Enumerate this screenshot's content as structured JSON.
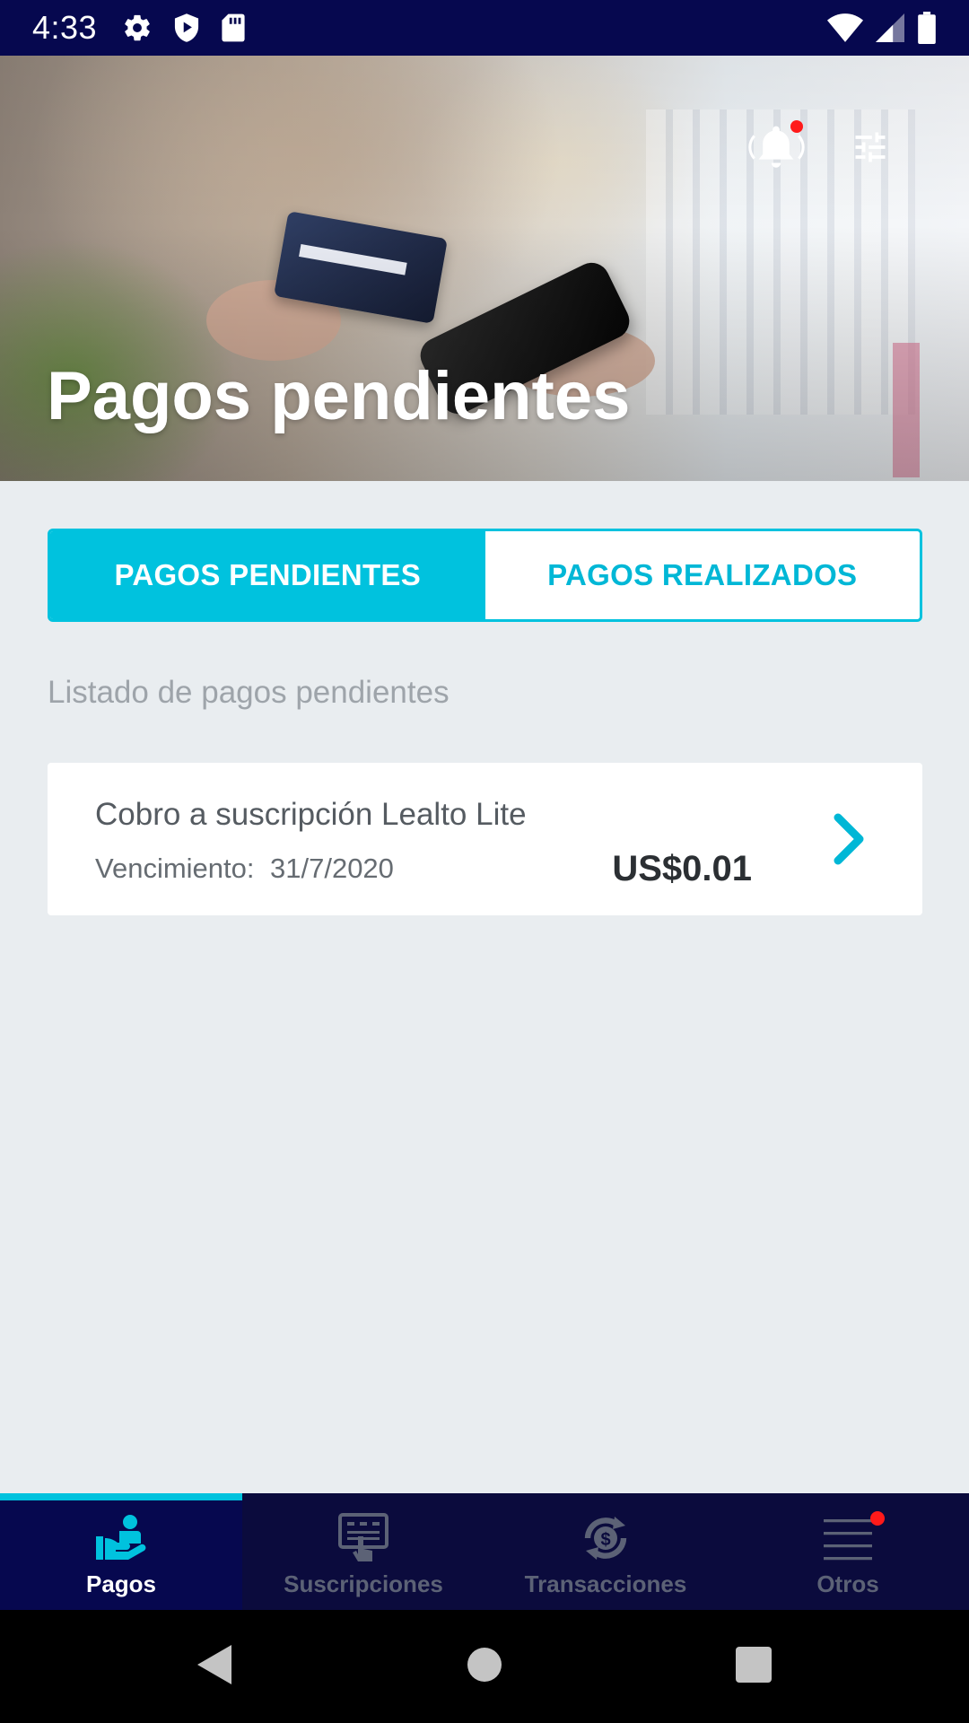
{
  "status_bar": {
    "time": "4:33",
    "left_icons": [
      "settings-icon",
      "shield-play-icon",
      "sd-card-icon"
    ],
    "right_icons": [
      "wifi-icon",
      "cell-signal-icon",
      "battery-icon"
    ]
  },
  "hero": {
    "title": "Pagos pendientes",
    "actions": [
      "bell-icon",
      "filter-sliders-icon"
    ],
    "notification_dot_color": "#ff1a1a"
  },
  "tabs": {
    "pending_label": "PAGOS PENDIENTES",
    "done_label": "PAGOS REALIZADOS",
    "active": "pending",
    "accent_color": "#00c2de"
  },
  "list": {
    "caption": "Listado de pagos pendientes",
    "items": [
      {
        "title": "Cobro a suscripción Lealto Lite",
        "due_label": "Vencimiento:",
        "due_date": "31/7/2020",
        "amount": "US$0.01"
      }
    ]
  },
  "bottom_nav": {
    "items": [
      {
        "label": "Pagos",
        "icon": "payments-hand-icon",
        "active": true
      },
      {
        "label": "Suscripciones",
        "icon": "subscriptions-icon",
        "active": false
      },
      {
        "label": "Transacciones",
        "icon": "transactions-exchange-icon",
        "active": false
      },
      {
        "label": "Otros",
        "icon": "menu-lines-icon",
        "active": false
      }
    ]
  },
  "system_nav": [
    "back-icon",
    "home-icon",
    "recents-icon"
  ],
  "colors": {
    "navy": "#06084f",
    "nav_bg": "#0b0b3d",
    "background": "#e9edf0"
  }
}
